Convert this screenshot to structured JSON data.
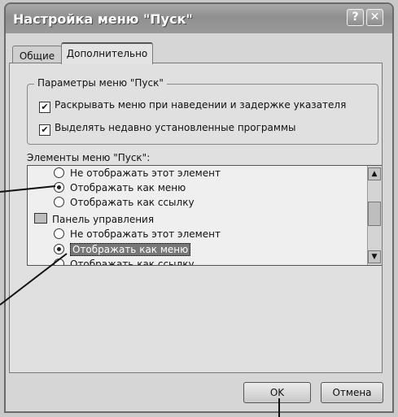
{
  "window": {
    "title": "Настройка меню \"Пуск\"",
    "help_symbol": "?",
    "close_symbol": "✕"
  },
  "tabs": [
    {
      "label": "Общие",
      "active": false
    },
    {
      "label": "Дополнительно",
      "active": true
    }
  ],
  "group": {
    "title": "Параметры меню \"Пуск\"",
    "checkboxes": [
      {
        "label": "Раскрывать меню при наведении и задержке указателя",
        "checked": true
      },
      {
        "label": "Выделять недавно установленные программы",
        "checked": true
      }
    ]
  },
  "list": {
    "label": "Элементы меню \"Пуск\":",
    "items": [
      {
        "kind": "radio",
        "label": "Не отображать этот элемент",
        "selected": false
      },
      {
        "kind": "radio",
        "label": "Отображать как меню",
        "selected": true
      },
      {
        "kind": "radio",
        "label": "Отображать как ссылку",
        "selected": false
      },
      {
        "kind": "folder",
        "label": "Панель управления"
      },
      {
        "kind": "radio",
        "label": "Не отображать этот элемент",
        "selected": false
      },
      {
        "kind": "radio",
        "label": "Отображать как меню",
        "selected": true,
        "highlighted": true
      },
      {
        "kind": "radio",
        "label": "Отображать как ссылку",
        "selected": false
      }
    ]
  },
  "buttons": {
    "ok": "OK",
    "cancel": "Отмена"
  },
  "icons": {
    "check": "✔",
    "scroll_up": "▲",
    "scroll_down": "▼"
  }
}
